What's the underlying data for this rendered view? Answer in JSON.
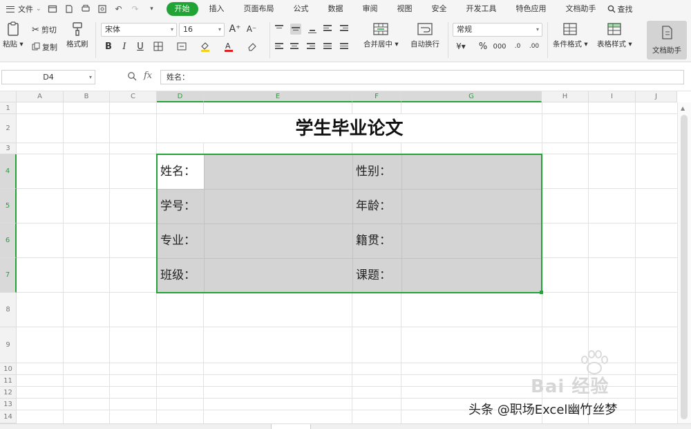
{
  "menubar": {
    "file_label": "文件",
    "tabs": [
      "开始",
      "插入",
      "页面布局",
      "公式",
      "数据",
      "审阅",
      "视图",
      "安全",
      "开发工具",
      "特色应用",
      "文档助手"
    ],
    "active_tab": "开始",
    "search_label": "查找",
    "accent_color": "#21a336"
  },
  "ribbon": {
    "paste_label": "粘贴",
    "cut_label": "剪切",
    "copy_label": "复制",
    "format_painter_label": "格式刷",
    "font_name": "宋体",
    "font_size": "16",
    "merge_center_label": "合并居中",
    "wrap_text_label": "自动换行",
    "number_format": "常规",
    "cond_format_label": "条件格式",
    "table_style_label": "表格样式",
    "doc_helper_label": "文档助手"
  },
  "formula_bar": {
    "name_box": "D4",
    "fx_label": "fx",
    "content": "姓名："
  },
  "sheet": {
    "columns": [
      "A",
      "B",
      "C",
      "D",
      "E",
      "F",
      "G",
      "H",
      "I",
      "J"
    ],
    "rows": [
      "1",
      "2",
      "3",
      "4",
      "5",
      "6",
      "7",
      "8",
      "9",
      "10",
      "11",
      "12",
      "13",
      "14"
    ],
    "title": "学生毕业论文",
    "cells": {
      "name_label": "姓名：",
      "student_id_label": "学号：",
      "major_label": "专业：",
      "class_label": "班级：",
      "gender_label": "性别：",
      "age_label": "年龄：",
      "origin_label": "籍贯：",
      "topic_label": "课题："
    }
  },
  "overlay": {
    "watermark_text": "Bai 经验",
    "credit": "头条 @职场Excel幽竹丝梦"
  }
}
